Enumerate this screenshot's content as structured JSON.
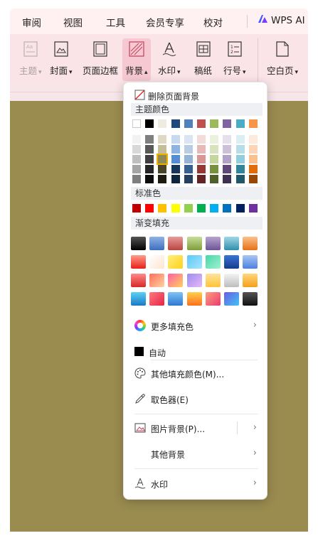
{
  "tabs": [
    "审阅",
    "视图",
    "工具",
    "会员专享",
    "校对",
    "WPS AI"
  ],
  "ribbon": {
    "items": [
      {
        "label": "主题",
        "caret": "▾",
        "icon": "theme-icon",
        "state": "disabled"
      },
      {
        "label": "封面",
        "caret": "▾",
        "icon": "cover-icon",
        "state": "normal"
      },
      {
        "label": "页面边框",
        "caret": "",
        "icon": "page-border-icon",
        "state": "normal"
      },
      {
        "label": "背景",
        "caret": "▴",
        "icon": "background-icon",
        "state": "active"
      },
      {
        "label": "水印",
        "caret": "▾",
        "icon": "watermark-icon",
        "state": "normal"
      },
      {
        "label": "稿纸",
        "caret": "",
        "icon": "manuscript-paper-icon",
        "state": "normal"
      },
      {
        "label": "行号",
        "caret": "▾",
        "icon": "line-number-icon",
        "state": "normal"
      },
      {
        "label": "空白页",
        "caret": "▾",
        "icon": "blank-page-icon",
        "state": "normal"
      }
    ]
  },
  "menu": {
    "delete_background": "删除页面背景",
    "theme_colors_header": "主题颜色",
    "theme_top_row": [
      "#ffffff",
      "#000000",
      "#eeece1",
      "#1f497d",
      "#4f81bd",
      "#c0504d",
      "#9bbb59",
      "#8064a2",
      "#4bacc6",
      "#f79646"
    ],
    "theme_shades": [
      [
        "#f2f2f2",
        "#7f7f7f",
        "#ddd9c3",
        "#c6d9f0",
        "#dbe5f1",
        "#f2dcdb",
        "#ebf1dd",
        "#e5e0ec",
        "#dbeef3",
        "#fdeada"
      ],
      [
        "#d8d8d8",
        "#595959",
        "#c4bd97",
        "#8db3e2",
        "#b8cce4",
        "#e5b9b7",
        "#d7e3bc",
        "#ccc1d9",
        "#b7dde8",
        "#fbd5b5"
      ],
      [
        "#bfbfbf",
        "#3f3f3f",
        "#938953",
        "#548dd4",
        "#95b3d7",
        "#d99694",
        "#c3d69b",
        "#b2a2c7",
        "#92cddc",
        "#fac08f"
      ],
      [
        "#a5a5a5",
        "#262626",
        "#494429",
        "#17365d",
        "#366092",
        "#953734",
        "#76923c",
        "#5f497a",
        "#31859b",
        "#e36c09"
      ],
      [
        "#7f7f7f",
        "#0c0c0c",
        "#1d1b10",
        "#0f243e",
        "#244061",
        "#632423",
        "#4f6128",
        "#3f3151",
        "#205867",
        "#974806"
      ]
    ],
    "selected_shade": "#938953",
    "standard_colors_header": "标准色",
    "standard_colors": [
      "#c00000",
      "#ff0000",
      "#ffc000",
      "#ffff00",
      "#92d050",
      "#00b050",
      "#00b0f0",
      "#0070c0",
      "#002060",
      "#7030a0"
    ],
    "gradient_header": "渐变填充",
    "gradients": [
      [
        "linear-gradient(#555,#000)",
        "linear-gradient(#8fb2e6,#3d6fbe)",
        "linear-gradient(#e99b99,#b84542)",
        "linear-gradient(#c8dd98,#7e9e3a)",
        "linear-gradient(#b7a5d0,#6d5496)",
        "linear-gradient(#9fd8e6,#2f8fab)",
        "linear-gradient(#fcc08a,#e67117)"
      ],
      [
        "linear-gradient(#ff9d8a,#e8201a)",
        "linear-gradient(135deg,#ffffff,#fde4d0)",
        "linear-gradient(135deg,#ffef7a,#ffd21e)",
        "linear-gradient(135deg,#5cc9f5,#a6e4ff)",
        "linear-gradient(135deg,#44d8a6,#a1f0d2)",
        "linear-gradient(#3b74d6,#173c8c)",
        "linear-gradient(#a9c6f5,#4d80e0)"
      ],
      [
        "linear-gradient(#ff8a8a,#d82828)",
        "linear-gradient(135deg,#ff6e5a,#ffd3a0)",
        "linear-gradient(135deg,#ff5fa6,#ffd15b)",
        "linear-gradient(135deg,#9a8cf0,#e8b9f7)",
        "linear-gradient(#ffe39a,#ffc43a)",
        "linear-gradient(#f3f3f3,#bdbdbd)",
        "linear-gradient(#ffd87a,#f59e1c)"
      ],
      [
        "linear-gradient(#5bd1f5,#1a7ac4)",
        "linear-gradient(135deg,#ff7a7a,#e6244a)",
        "linear-gradient(#7ec2f7,#2f78d2)",
        "linear-gradient(#ffd04a,#ff6f1f)",
        "linear-gradient(135deg,#ff9d7a,#e83a73)",
        "linear-gradient(135deg,#6b5ce7,#40c4f3)",
        "linear-gradient(#555,#111)"
      ]
    ],
    "more_fill": "更多填充色",
    "auto": "自动",
    "other_fill": "其他填充颜色(M)...",
    "eyedropper": "取色器(E)",
    "picture_bg": "图片背景(P)...",
    "other_bg": "其他背景",
    "watermark": "水印"
  },
  "colors": {
    "tab_bar": "#fff0f2",
    "ribbon": "#fbe4e8",
    "active_button": "#f6c9d2",
    "document": "#9a8b4f",
    "selection_outline": "#f0b400"
  }
}
